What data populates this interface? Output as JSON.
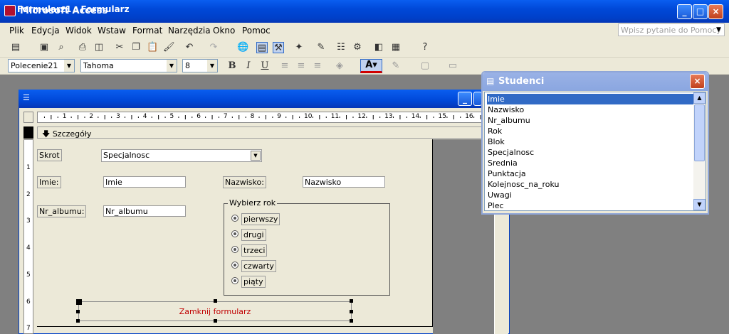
{
  "app": {
    "title": "Microsoft Access"
  },
  "menu": {
    "items": [
      "Plik",
      "Edycja",
      "Widok",
      "Wstaw",
      "Format",
      "Narzędzia",
      "Okno",
      "Pomoc"
    ],
    "help_placeholder": "Wpisz pytanie do Pomocy"
  },
  "format_toolbar": {
    "object": "Polecenie21",
    "font": "Tahoma",
    "size": "8"
  },
  "form_window": {
    "title": "Formularz1 : Formularz",
    "section": "Szczegóły",
    "ruler_h": [
      "1",
      "2",
      "3",
      "4",
      "5",
      "6",
      "7",
      "8",
      "9",
      "10",
      "11",
      "12",
      "13",
      "14",
      "15",
      "16"
    ],
    "ruler_v": [
      "1",
      "2",
      "3",
      "4",
      "5",
      "6",
      "7"
    ]
  },
  "form": {
    "skrot_label": "Skrot",
    "specjalnosc_combo": "Specjalnosc",
    "imie_label": "Imie:",
    "imie_field": "Imie",
    "nazwisko_label": "Nazwisko:",
    "nazwisko_field": "Nazwisko",
    "nralbumu_label": "Nr_albumu:",
    "nralbumu_field": "Nr_albumu",
    "group_label": "Wybierz rok",
    "options": [
      "pierwszy",
      "drugi",
      "trzeci",
      "czwarty",
      "piąty"
    ],
    "close_button": "Zamknij formularz"
  },
  "field_list": {
    "title": "Studenci",
    "selected": "Imie",
    "items": [
      "Imie",
      "Nazwisko",
      "Nr_albumu",
      "Rok",
      "Blok",
      "Specjalnosc",
      "Srednia",
      "Punktacja",
      "Kolejnosc_na_roku",
      "Uwagi",
      "Plec"
    ]
  }
}
